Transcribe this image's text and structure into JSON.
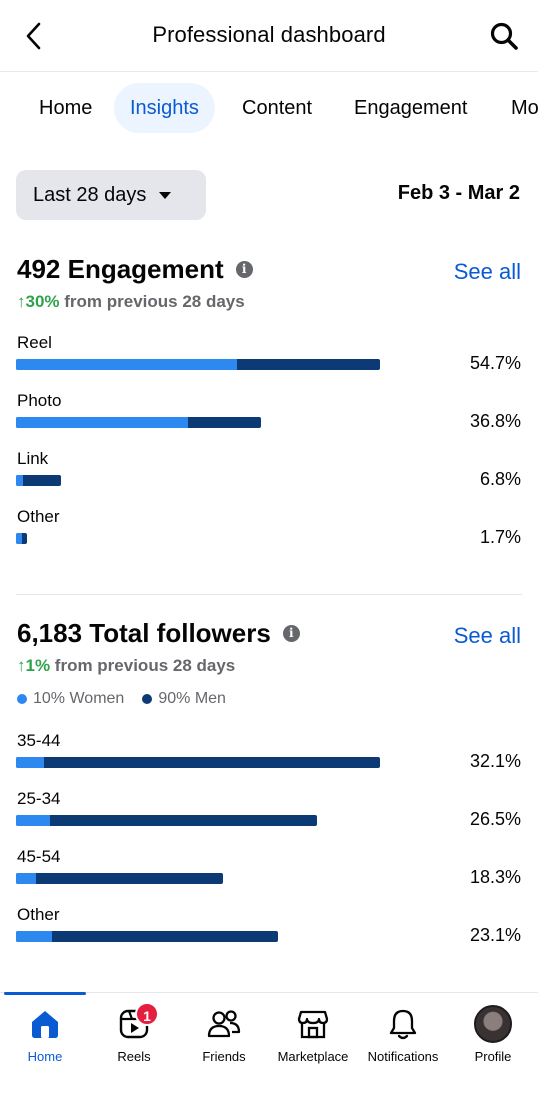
{
  "header": {
    "title": "Professional dashboard"
  },
  "tabs": [
    {
      "label": "Home"
    },
    {
      "label": "Insights"
    },
    {
      "label": "Content"
    },
    {
      "label": "Engagement"
    },
    {
      "label": "Mo"
    }
  ],
  "filters": {
    "range_label": "Last 28 days",
    "date_range": "Feb 3 - Mar 2"
  },
  "engagement": {
    "title": "492 Engagement",
    "see_all": "See all",
    "trend_value": "↑30%",
    "trend_text": " from previous 28 days",
    "rows": [
      {
        "label": "Reel",
        "value": "54.7%",
        "total": 1.0,
        "light": 0.607
      },
      {
        "label": "Photo",
        "value": "36.8%",
        "total": 0.673,
        "light": 0.703
      },
      {
        "label": "Link",
        "value": "6.8%",
        "total": 0.124,
        "light": 0.16
      },
      {
        "label": "Other",
        "value": "1.7%",
        "total": 0.03,
        "light": 0.5
      }
    ]
  },
  "followers": {
    "title": "6,183 Total followers",
    "see_all": "See all",
    "trend_value": "↑1%",
    "trend_text": " from previous 28 days",
    "women_value": "10%",
    "women_label": "Women",
    "men_value": "90%",
    "men_label": "Men",
    "rows": [
      {
        "label": "35-44",
        "value": "32.1%",
        "total": 1.0,
        "light": 0.076
      },
      {
        "label": "25-34",
        "value": "26.5%",
        "total": 0.826,
        "light": 0.113
      },
      {
        "label": "45-54",
        "value": "18.3%",
        "total": 0.57,
        "light": 0.097
      },
      {
        "label": "Other",
        "value": "23.1%",
        "total": 0.72,
        "light": 0.138
      }
    ]
  },
  "colors": {
    "accent": "#0a5bd3",
    "bar_light": "#2d88f0",
    "bar_dark": "#0b3a74",
    "trend_up": "#31a24c",
    "badge": "#e41e3f"
  },
  "nav": [
    {
      "label": "Home",
      "icon": "home-icon"
    },
    {
      "label": "Reels",
      "icon": "reels-icon",
      "badge": "1"
    },
    {
      "label": "Friends",
      "icon": "friends-icon"
    },
    {
      "label": "Marketplace",
      "icon": "marketplace-icon"
    },
    {
      "label": "Notifications",
      "icon": "bell-icon"
    },
    {
      "label": "Profile",
      "icon": "avatar"
    }
  ]
}
